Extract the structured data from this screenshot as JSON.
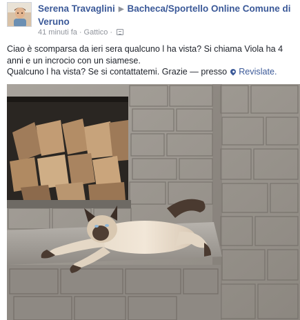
{
  "post": {
    "author": "Serena Travaglini",
    "target": "Bacheca/Sportello Online Comune di Veruno",
    "time": "41 minuti fa",
    "place": "Gattico",
    "text_line1": "Ciao è scomparsa da ieri sera qualcuno l ha vista? Si chiama Viola ha 4 anni e un incrocio con un siamese.",
    "text_line2": "Qualcuno l ha vista? Se si contattatemi. Grazie — presso",
    "location": "Revislate."
  },
  "icons": {
    "separator": "triangle-right-icon",
    "privacy": "globe-icon",
    "location": "map-pin-icon"
  },
  "colors": {
    "link": "#3b5998",
    "meta": "#90949c",
    "text": "#1d2129"
  }
}
